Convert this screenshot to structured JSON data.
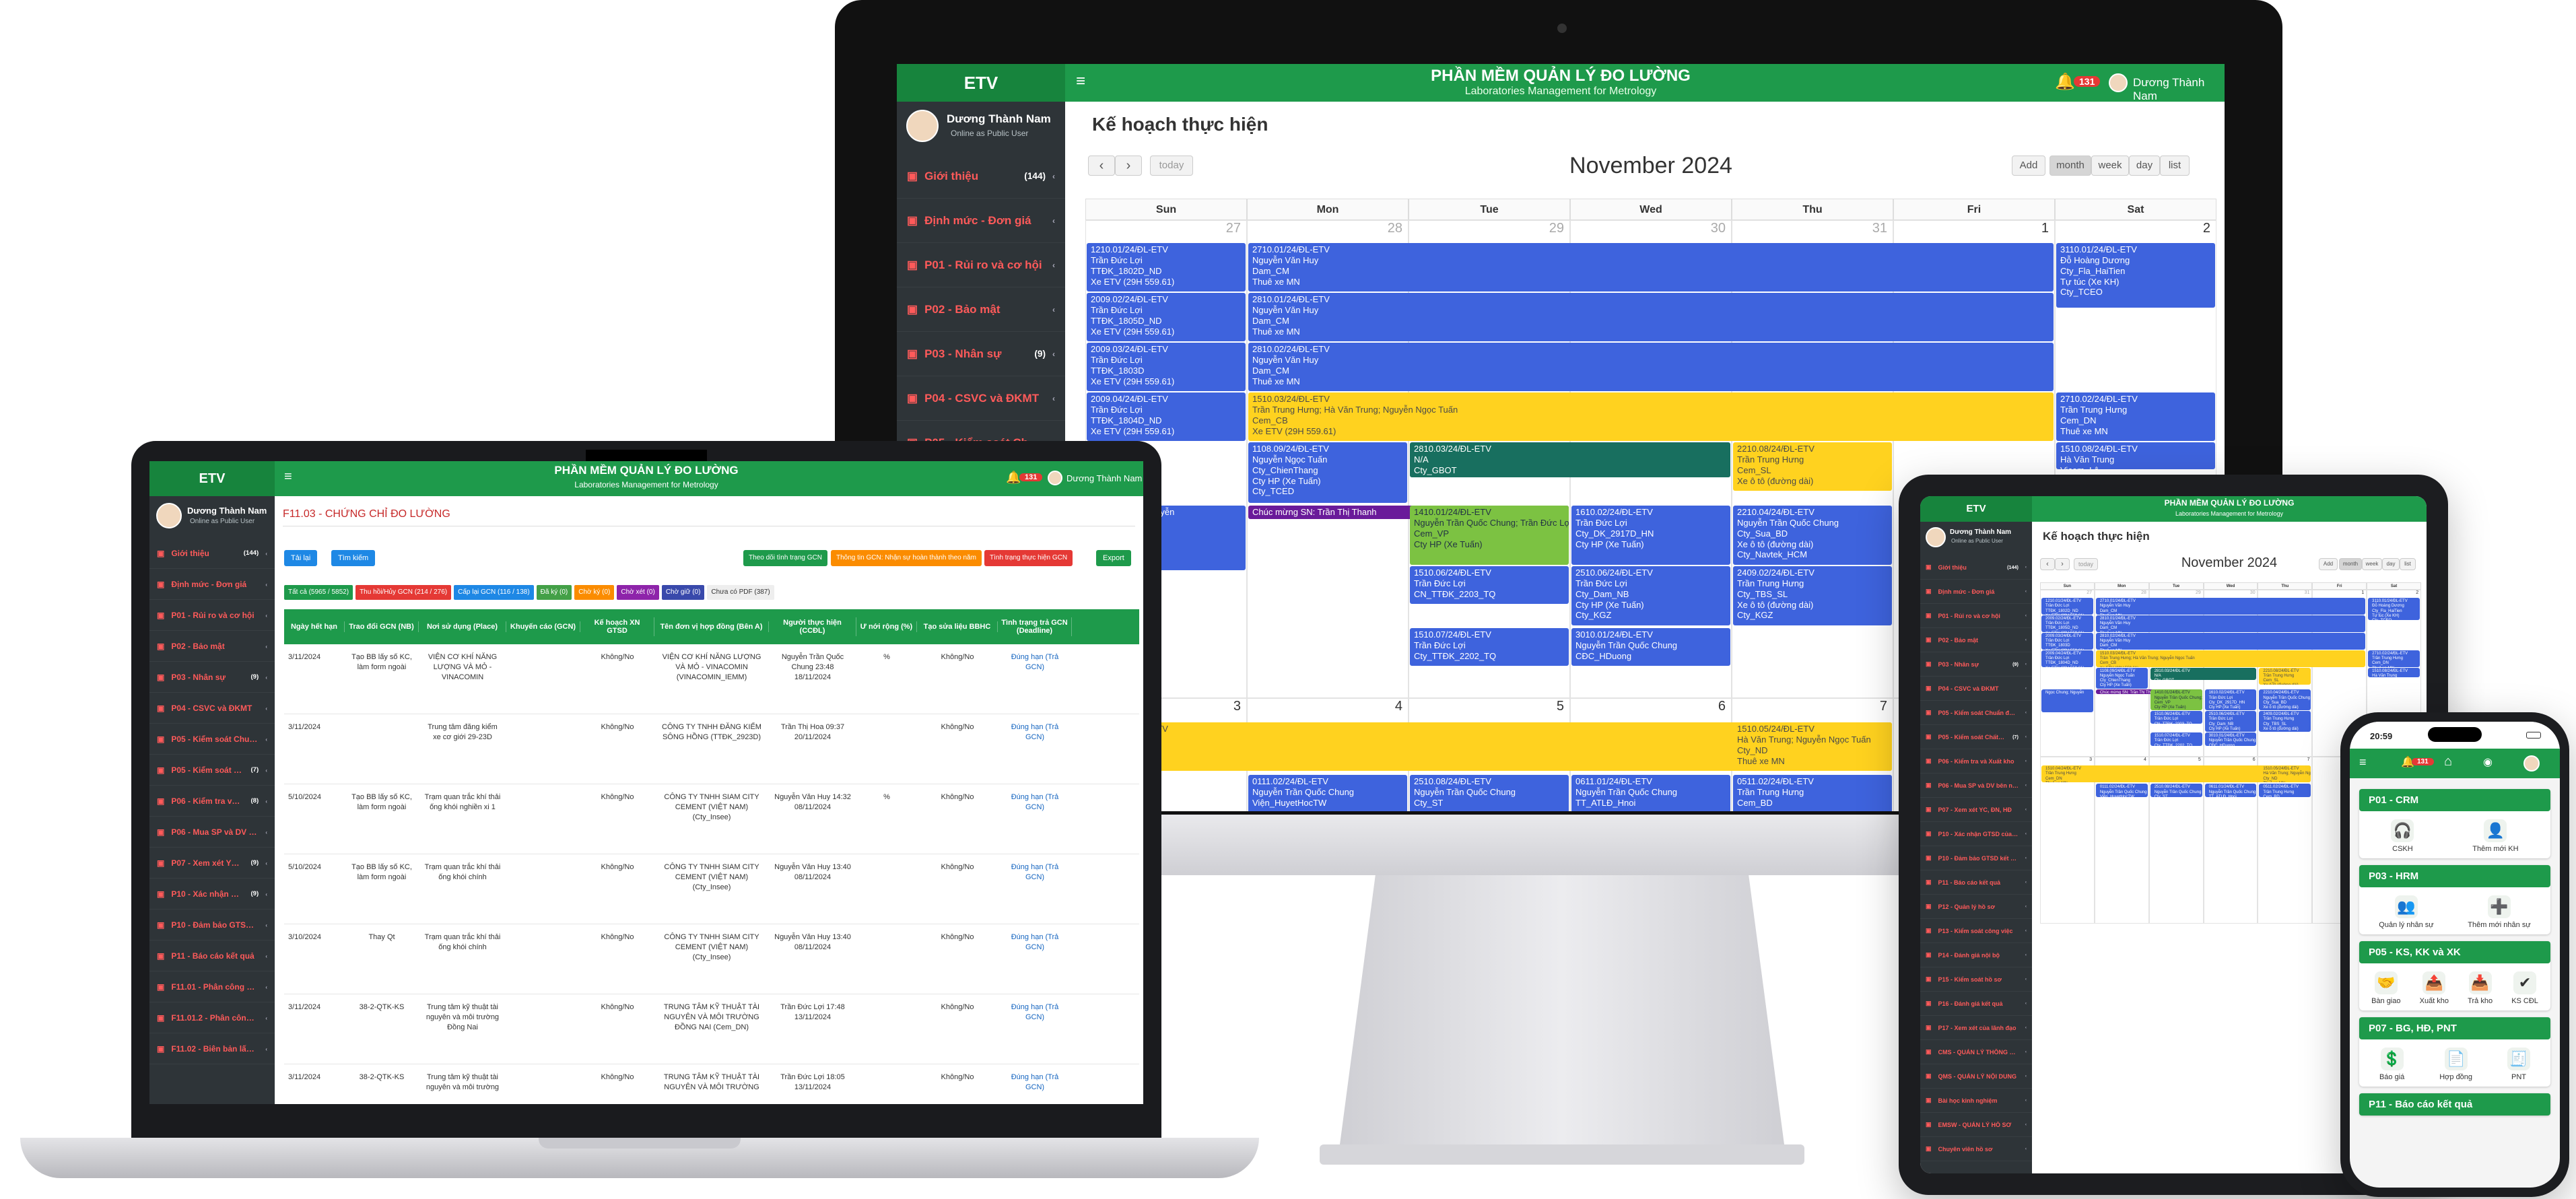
{
  "app": {
    "brand": "ETV",
    "title": "PHẦN MỀM QUẢN LÝ ĐO LƯỜNG",
    "subtitle": "Laboratories Management for Metrology",
    "user_name": "Dương Thành Nam",
    "user_status": "Online as Public User",
    "notif_count": "131"
  },
  "sidebar": {
    "items": [
      {
        "label": "Giới thiệu",
        "badge": "(144)"
      },
      {
        "label": "Định mức - Đơn giá",
        "badge": ""
      },
      {
        "label": "P01 - Rủi ro và cơ hội",
        "badge": ""
      },
      {
        "label": "P02 - Bảo mật",
        "badge": ""
      },
      {
        "label": "P03 - Nhân sự",
        "badge": "(9)"
      },
      {
        "label": "P04 - CSVC và ĐKMT",
        "badge": ""
      },
      {
        "label": "P05 - Kiểm soát Chuẩn đo lường",
        "badge": ""
      },
      {
        "label": "P05 - Kiểm soát Chất chuẩn",
        "badge": "(7)"
      }
    ],
    "laptop_extra": [
      {
        "label": "P06 - Kiểm tra và Xuất kho",
        "badge": "(8)"
      },
      {
        "label": "P06 - Mua SP và DV bên ngoài",
        "badge": ""
      },
      {
        "label": "P07 - Xem xét YC, ĐN, HĐ",
        "badge": "(9)"
      },
      {
        "label": "P10 - Xác nhận GTSD của phương pháp",
        "badge": "(9)"
      },
      {
        "label": "P10 - Đảm bảo GTSD của kết quả",
        "badge": ""
      },
      {
        "label": "P11 - Báo cáo kết quả",
        "badge": ""
      },
      {
        "label": "F11.01 - Phân công công việc",
        "badge": ""
      },
      {
        "label": "F11.01.2 - Phân công công việc (NTP)",
        "badge": ""
      },
      {
        "label": "F11.02 - Biên bản lấy mẫu",
        "badge": ""
      }
    ]
  },
  "calendar": {
    "heading": "Kế hoạch thực hiện",
    "month": "November 2024",
    "today": "today",
    "add": "Add",
    "views": [
      "month",
      "week",
      "day",
      "list"
    ],
    "days": [
      "Sun",
      "Mon",
      "Tue",
      "Wed",
      "Thu",
      "Fri",
      "Sat"
    ],
    "week1": [
      "27",
      "28",
      "29",
      "30",
      "31",
      "1",
      "2"
    ],
    "week2": [
      "3",
      "4",
      "5",
      "6",
      "7",
      "8",
      "9"
    ],
    "events": [
      {
        "t": "1210.01/24/ĐL-ETV\nTrần Đức Lợi\nTTĐK_1802D_ND\nXe ETV (29H 559.61)"
      },
      {
        "t": "2009.02/24/ĐL-ETV\nTrần Đức Lợi\nTTĐK_1805D_ND\nXe ETV (29H 559.61)"
      },
      {
        "t": "2009.03/24/ĐL-ETV\nTrần Đức Lợi\nTTĐK_1803D\nXe ETV (29H 559.61)"
      },
      {
        "t": "2009.04/24/ĐL-ETV\nTrần Đức Lợi\nTTĐK_1804D_ND\nXe ETV (29H 559.61)"
      },
      {
        "t": "2710.01/24/ĐL-ETV\nNguyễn Văn Huy\nDam_CM\nThuê xe MN"
      },
      {
        "t": "2810.01/24/ĐL-ETV\nNguyễn Văn Huy\nDam_CM\nThuê xe MN"
      },
      {
        "t": "2810.02/24/ĐL-ETV\nNguyễn Văn Huy\nDam_CM\nThuê xe MN"
      },
      {
        "t": "3110.01/24/ĐL-ETV\nĐỗ Hoàng Dương\nCty_Fla_HaiTien\nTự túc (Xe KH)\nCty_TCEO"
      },
      {
        "t": "1510.03/24/ĐL-ETV\nTrần Trung Hưng; Hà Văn Trung; Nguyễn Ngọc Tuấn\nCem_CB\nXe ETV (29H 559.61)"
      },
      {
        "t": "2710.02/24/ĐL-ETV\nTrần Trung Hưng\nCem_DN\nThuê xe MN"
      },
      {
        "t": "1510.08/24/ĐL-ETV\nHà Văn Trung\nVicem_Lâ"
      },
      {
        "t": "1108.09/24/ĐL-ETV\nNguyễn Ngọc Tuấn\nCty_ChienThang\nCty HP (Xe Tuấn)\nCty_TCED"
      },
      {
        "t": "2810.03/24/ĐL-ETV\nN/A\nCty_GBOT"
      },
      {
        "t": "2210.08/24/ĐL-ETV\nTrần Trung Hưng\nCem_SL\nXe ô tô (đường dài)"
      },
      {
        "t": "Chúc mừng SN: Trần Thị Thanh"
      },
      {
        "t": "1410.01/24/ĐL-ETV\nNguyễn Trần Quốc Chung; Trần Đức Lợi\nCem_VP\nCty HP (Xe Tuấn)"
      },
      {
        "t": "1610.02/24/ĐL-ETV\nTrần Đức Lợi\nCty_DK_2917D_HN\nCty HP (Xe Tuấn)"
      },
      {
        "t": "2210.04/24/ĐL-ETV\nNguyễn Trần Quốc Chung\nCty_Sua_BD\nXe ô tô (đường dài)\nCty_Navtek_HCM"
      },
      {
        "t": "1510.06/24/ĐL-ETV\nTrần Đức Lợi\nCN_TTĐK_2203_TQ"
      },
      {
        "t": "2510.06/24/ĐL-ETV\nTrần Đức Lợi\nCty_Dam_NB\nCty HP (Xe Tuấn)\nCty_KGZ"
      },
      {
        "t": "2409.02/24/ĐL-ETV\nTrần Trung Hưng\nCty_TBS_SL\nXe ô tô (đường dài)\nCty_KGZ"
      },
      {
        "t": "1510.07/24/ĐL-ETV\nTrần Đức Lợi\nCty_TTĐK_2202_TQ"
      },
      {
        "t": "3010.01/24/ĐL-ETV\nNguyễn Trần Quốc Chung\nCĐC_HDuong"
      },
      {
        "t": "1510.04/24/ĐL-ETV\nTrần Trung Hưng\nCem_DN\nThuê xe MN"
      },
      {
        "t": "0111.02/24/ĐL-ETV\nNguyễn Trần Quốc Chung\nViện_HuyetHocTW"
      },
      {
        "t": "2510.08/24/ĐL-ETV\nNguyễn Trần Quốc Chung\nCty_ST"
      },
      {
        "t": "0611.01/24/ĐL-ETV\nNguyễn Trần Quốc Chung\nTT_ATLĐ_Hnoi"
      },
      {
        "t": "1510.05/24/ĐL-ETV\nHà Văn Trung; Nguyễn Ngọc Tuấn\nCty_ND\nThuê xe MN"
      },
      {
        "t": "0511.02/24/ĐL-ETV\nTrần Trung Hưng\nCem_BD"
      },
      {
        "t": "Ngọc Chung; Nguyễn"
      }
    ]
  },
  "laptop": {
    "page_title": "F11.03 - CHỨNG CHỈ ĐO LƯỜNG",
    "btn_add": "Tải lại",
    "btn_search": "Tìm kiếm",
    "btn_edit": "Theo dõi tình trạng GCN",
    "btn_notify": "Thông tin GCN: Nhận sự hoàn thành theo năm",
    "btn_status": "Tình trạng thực hiện GCN",
    "btn_export": "Export",
    "filters": [
      {
        "label": "Tất cả (5965 / 5852)",
        "color": "#1e9a4b"
      },
      {
        "label": "Thu hồi/Hủy GCN (214 / 276)",
        "color": "#e53935"
      },
      {
        "label": "Cấp lại GCN (116 / 138)",
        "color": "#1e88e5"
      },
      {
        "label": "Đã ký (0)",
        "color": "#43a047"
      },
      {
        "label": "Chờ ký (0)",
        "color": "#fb8c00"
      },
      {
        "label": "Chờ xét (0)",
        "color": "#8e24aa"
      },
      {
        "label": "Chờ giữ (0)",
        "color": "#3949ab"
      },
      {
        "label": "Chưa có PDF (387)",
        "color": "#eeeeee"
      }
    ],
    "columns": [
      "Ngày hết hạn",
      "Trao đổi GCN (NB)",
      "Nơi sử dụng (Place)",
      "Khuyến cáo (GCN)",
      "Kế hoạch XN GTSD",
      "Tên đơn vị hợp đồng (Bên A)",
      "Người thực hiện (CCĐL)",
      "Ư nới rộng (%)",
      "Tạo sửa liệu BBHC",
      "Tình trạng trả GCN (Deadline)"
    ],
    "rows": [
      [
        "3/11/2024",
        "Tạo BB lấy số KC, làm form ngoài",
        "VIỆN CƠ KHÍ NĂNG LƯỢNG VÀ MỎ - VINACOMIN",
        "",
        "Không/No",
        "VIỆN CƠ KHÍ NĂNG LƯỢNG VÀ MỎ - VINACOMIN (VINACOMIN_IEMM)",
        "Nguyễn Trần Quốc Chung 23:48 18/11/2024",
        "%",
        "Không/No",
        "Đúng hạn (Trả GCN)"
      ],
      [
        "3/11/2024",
        "",
        "Trung tâm đăng kiểm xe cơ giới 29-23D",
        "",
        "Không/No",
        "CÔNG TY TNHH ĐĂNG KIỂM SÔNG HỒNG (TTĐK_2923D)",
        "Trần Thị Hoa 09:37 20/11/2024",
        "",
        "Không/No",
        "Đúng hạn (Trả GCN)"
      ],
      [
        "5/10/2024",
        "Tạo BB lấy số KC, làm form ngoài",
        "Trạm quan trắc khí thải ống khói nghiền xi 1",
        "",
        "Không/No",
        "CÔNG TY TNHH SIAM CITY CEMENT (VIỆT NAM) (Cty_Insee)",
        "Nguyễn Văn Huy 14:32 08/11/2024",
        "%",
        "Không/No",
        "Đúng hạn (Trả GCN)"
      ],
      [
        "5/10/2024",
        "Tạo BB lấy số KC, làm form ngoài",
        "Trạm quan trắc khí thải ống khói chính",
        "",
        "Không/No",
        "CÔNG TY TNHH SIAM CITY CEMENT (VIỆT NAM) (Cty_Insee)",
        "Nguyễn Văn Huy 13:40 08/11/2024",
        "",
        "Không/No",
        "Đúng hạn (Trả GCN)"
      ],
      [
        "3/10/2024",
        "Thay Qt",
        "Trạm quan trắc khí thải ống khói chính",
        "",
        "Không/No",
        "CÔNG TY TNHH SIAM CITY CEMENT (VIỆT NAM) (Cty_Insee)",
        "Nguyễn Văn Huy 13:40 08/11/2024",
        "",
        "Không/No",
        "Đúng hạn (Trả GCN)"
      ],
      [
        "3/11/2024",
        "38-2-QTK-KS",
        "Trung tâm kỹ thuật tài nguyên và môi trường Đồng Nai",
        "",
        "Không/No",
        "TRUNG TÂM KỸ THUẬT TÀI NGUYÊN VÀ MÔI TRƯỜNG ĐỒNG NAI (Cem_DN)",
        "Trần Đức Lợi 17:48 13/11/2024",
        "",
        "Không/No",
        "Đúng hạn (Trả GCN)"
      ],
      [
        "3/11/2024",
        "38-2-QTK-KS",
        "Trung tâm kỹ thuật tài nguyên và môi trường",
        "",
        "Không/No",
        "TRUNG TÂM KỸ THUẬT TÀI NGUYÊN VÀ MÔI TRƯỜNG",
        "Trần Đức Lợi 18:05 13/11/2024",
        "",
        "Không/No",
        "Đúng hạn (Trả GCN)"
      ]
    ]
  },
  "tablet": {
    "extra_items": [
      {
        "label": "P06 - Kiểm tra và Xuất kho",
        "badge": ""
      },
      {
        "label": "P06 - Mua SP và DV bên ngoài",
        "badge": ""
      },
      {
        "label": "P07 - Xem xét YC, ĐN, HĐ",
        "badge": ""
      },
      {
        "label": "P10 - Xác nhận GTSD của phương pháp",
        "badge": ""
      },
      {
        "label": "P10 - Đảm bảo GTSD kết quả",
        "badge": ""
      },
      {
        "label": "P11 - Báo cáo kết quả",
        "badge": ""
      },
      {
        "label": "P12 - Quản lý hồ sơ",
        "badge": ""
      },
      {
        "label": "P13 - Kiểm soát công việc",
        "badge": ""
      },
      {
        "label": "P14 - Đánh giá nội bộ",
        "badge": ""
      },
      {
        "label": "P15 - Kiểm soát hồ sơ",
        "badge": ""
      },
      {
        "label": "P16 - Đánh giá kết quả",
        "badge": ""
      },
      {
        "label": "P17 - Xem xét của lãnh đạo",
        "badge": ""
      },
      {
        "label": "CMS - QUẢN LÝ THÔNG TIN",
        "badge": ""
      },
      {
        "label": "QMS - QUẢN LÝ NỘI DUNG",
        "badge": ""
      },
      {
        "label": "Bài học kinh nghiệm",
        "badge": ""
      },
      {
        "label": "EMSW - QUẢN LÝ HỒ SƠ",
        "badge": ""
      },
      {
        "label": "Chuyên viên hồ sơ",
        "badge": ""
      }
    ]
  },
  "phone": {
    "time": "20:59",
    "notif": "131",
    "sections": [
      {
        "title": "P01 - CRM",
        "items": [
          {
            "label": "CSKH",
            "icon": "headset-icon"
          },
          {
            "label": "Thêm mới KH",
            "icon": "user-plus-icon"
          }
        ]
      },
      {
        "title": "P03 - HRM",
        "items": [
          {
            "label": "Quản lý nhân sự",
            "icon": "users-icon"
          },
          {
            "label": "Thêm mới nhân sự",
            "icon": "user-add-icon"
          }
        ]
      },
      {
        "title": "P05 - KS, KK và XK",
        "items": [
          {
            "label": "Bàn giao",
            "icon": "handover-icon"
          },
          {
            "label": "Xuất kho",
            "icon": "export-icon"
          },
          {
            "label": "Trả kho",
            "icon": "return-icon"
          },
          {
            "label": "KS CĐL",
            "icon": "check-icon"
          }
        ]
      },
      {
        "title": "P07 - BG, HĐ, PNT",
        "items": [
          {
            "label": "Báo giá",
            "icon": "quote-icon"
          },
          {
            "label": "Hợp đồng",
            "icon": "contract-icon"
          },
          {
            "label": "PNT",
            "icon": "receipt-icon"
          }
        ]
      },
      {
        "title": "P11 - Báo cáo kết quả",
        "items": []
      }
    ]
  }
}
